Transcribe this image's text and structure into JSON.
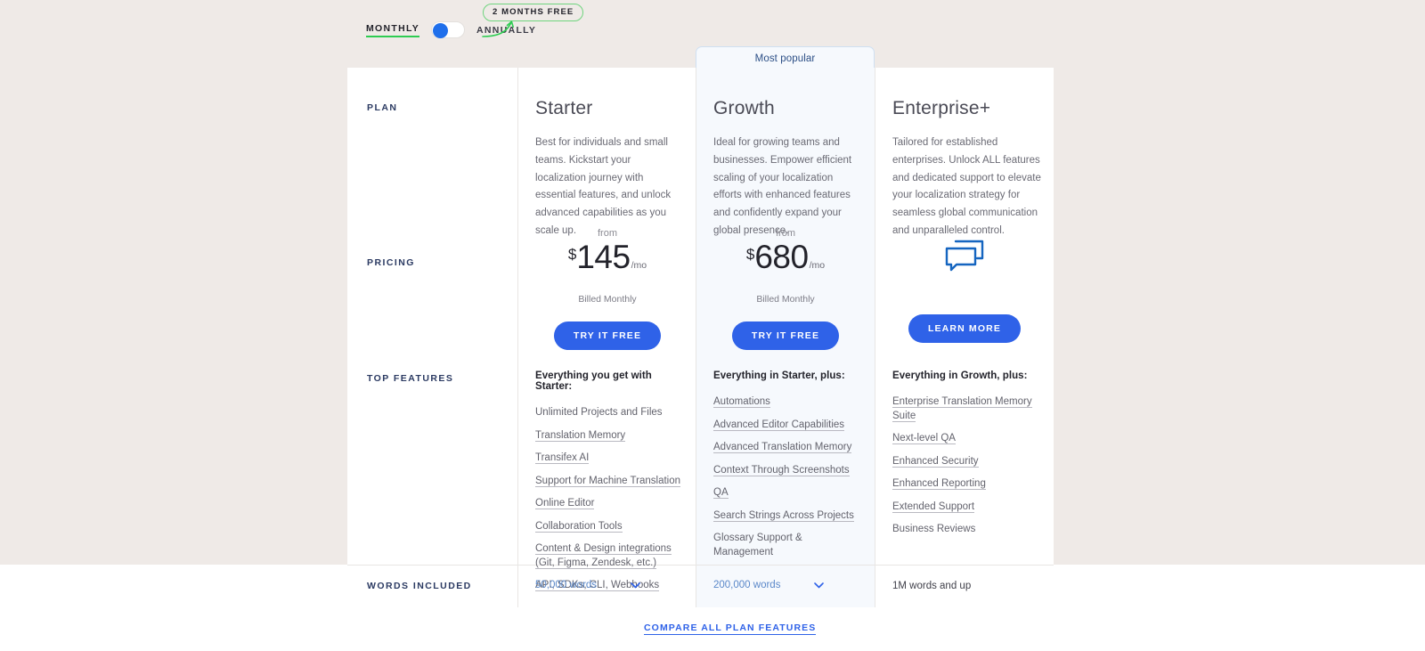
{
  "billing_toggle": {
    "monthly_label": "MONTHLY",
    "annually_label": "ANNUALLY",
    "promo_badge": "2 MONTHS FREE",
    "selected": "MONTHLY",
    "accent_color": "#2ecc52",
    "knob_color": "#1f6feb"
  },
  "row_labels": {
    "plan": "PLAN",
    "pricing": "PRICING",
    "top_features": "TOP FEATURES",
    "words_included": "WORDS INCLUDED"
  },
  "highlight": {
    "banner_label": "Most popular",
    "banner_bg": "#f6f9fd",
    "banner_border": "#cfe0f2"
  },
  "plans": [
    {
      "name": "Starter",
      "description": "Best for individuals and small teams. Kickstart your localization journey with essential features, and unlock advanced capabilities as you scale up.",
      "price_prefix": "from",
      "currency": "$",
      "amount": "145",
      "period": "/mo",
      "billed_note": "Billed Monthly",
      "cta_label": "TRY IT FREE",
      "features_heading": "Everything you get with Starter:",
      "features": [
        {
          "label": "Unlimited Projects and Files",
          "link": false
        },
        {
          "label": "Translation Memory",
          "link": true
        },
        {
          "label": "Transifex AI",
          "link": true
        },
        {
          "label": "Support for Machine Translation",
          "link": true
        },
        {
          "label": "Online Editor",
          "link": true
        },
        {
          "label": "Collaboration Tools",
          "link": true
        },
        {
          "label": "Content & Design integrations (Git, Figma, Zendesk, etc.)",
          "link": true
        },
        {
          "label": "API, SDKs, CLI, Webhooks",
          "link": true
        }
      ],
      "words_included": "50,000 words",
      "words_has_chevron": true
    },
    {
      "name": "Growth",
      "description": "Ideal for growing teams and businesses. Empower efficient scaling of your localization efforts with enhanced features and confidently expand your global presence.",
      "price_prefix": "from",
      "currency": "$",
      "amount": "680",
      "period": "/mo",
      "billed_note": "Billed Monthly",
      "cta_label": "TRY IT FREE",
      "features_heading": "Everything in Starter, plus:",
      "features": [
        {
          "label": "Automations",
          "link": true
        },
        {
          "label": "Advanced Editor Capabilities",
          "link": true
        },
        {
          "label": "Advanced Translation Memory",
          "link": true
        },
        {
          "label": "Context Through Screenshots",
          "link": true
        },
        {
          "label": "QA",
          "link": true
        },
        {
          "label": "Search Strings Across Projects",
          "link": true
        },
        {
          "label": "Glossary Support & Management",
          "link": false
        }
      ],
      "words_included": "200,000 words",
      "words_has_chevron": true
    },
    {
      "name": "Enterprise+",
      "description": "Tailored for established enterprises. Unlock ALL features and dedicated support to elevate your localization strategy for seamless global communication and unparalleled control.",
      "price_icon": "chat-bubbles-icon",
      "cta_label": "LEARN MORE",
      "features_heading": "Everything in Growth, plus:",
      "features": [
        {
          "label": "Enterprise Translation Memory Suite",
          "link": true
        },
        {
          "label": "Next-level QA",
          "link": true
        },
        {
          "label": "Enhanced Security",
          "link": true
        },
        {
          "label": "Enhanced Reporting",
          "link": true
        },
        {
          "label": "Extended Support",
          "link": true
        },
        {
          "label": "Business Reviews",
          "link": false
        }
      ],
      "words_included": "1M words and up",
      "words_has_chevron": false
    }
  ],
  "footer": {
    "compare_link": "COMPARE ALL PLAN FEATURES"
  },
  "theme": {
    "page_bg": "#efeae7",
    "card_bg": "#ffffff",
    "cta_blue": "#2f62e8",
    "icon_blue": "#1565c0",
    "link_blue": "#5b88c9"
  }
}
